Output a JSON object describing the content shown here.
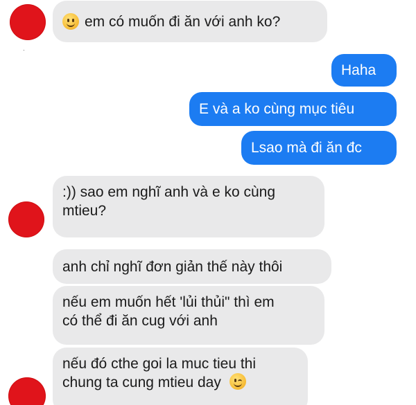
{
  "messages": [
    {
      "sender": "contact",
      "text": "em có muốn đi ăn với anh ko?",
      "emoji_before": "smiling-face"
    },
    {
      "sender": "me",
      "text": "Haha"
    },
    {
      "sender": "me",
      "text": "E và a ko cùng mục tiêu"
    },
    {
      "sender": "me",
      "text": "Lsao mà đi ăn đc"
    },
    {
      "sender": "contact",
      "lines": [
        ":)) sao em nghĩ anh và e ko cùng",
        "mtieu?"
      ]
    },
    {
      "sender": "contact",
      "text": "anh chỉ nghĩ đơn giản thế này thôi"
    },
    {
      "sender": "contact",
      "lines": [
        "nếu em muốn hết 'lủi thủi\" thì em",
        "có thể đi ăn cug với anh"
      ]
    },
    {
      "sender": "contact",
      "lines": [
        "nếu đó cthe goi la muc tieu thi",
        "chung ta cung mtieu day"
      ],
      "emoji_after": "winking-face"
    }
  ],
  "colors": {
    "incoming_bubble": "#e9e9ea",
    "outgoing_bubble": "#1c7cf2",
    "avatar_redaction": "#e0141b"
  },
  "icons": [
    "smiling-face-emoji",
    "winking-face-emoji"
  ]
}
